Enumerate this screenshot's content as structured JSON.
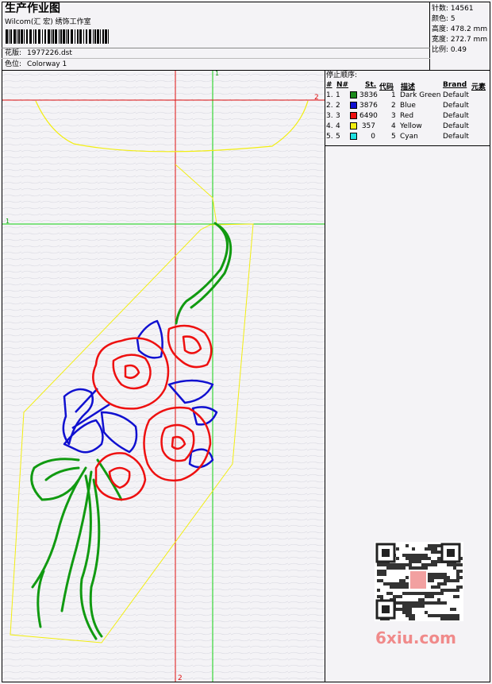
{
  "header": {
    "title": "生产作业图",
    "company": "Wilcom(汇 宏) 绣饰工作室",
    "design_label": "花版:",
    "design_value": "1977226.dst",
    "colorway_label": "色位:",
    "colorway_value": "Colorway 1"
  },
  "info": [
    {
      "label": "针数:",
      "value": "14561"
    },
    {
      "label": "颜色:",
      "value": "5"
    },
    {
      "label": "高度:",
      "value": "478.2 mm"
    },
    {
      "label": "宽度:",
      "value": "272.7 mm"
    },
    {
      "label": "比例:",
      "value": "0.49"
    }
  ],
  "stop_sequence": {
    "title": "停止顺序:",
    "columns": [
      "#",
      "N#",
      "St.",
      "代码",
      "描述",
      "Brand",
      "元素"
    ],
    "rows": [
      {
        "idx": "1.",
        "n": "1",
        "st": "3836",
        "code": "1",
        "desc": "Dark Green",
        "brand": "Default",
        "color": "#1a8a1a"
      },
      {
        "idx": "2.",
        "n": "2",
        "st": "3876",
        "code": "2",
        "desc": "Blue",
        "brand": "Default",
        "color": "#1010d0"
      },
      {
        "idx": "3.",
        "n": "3",
        "st": "6490",
        "code": "3",
        "desc": "Red",
        "brand": "Default",
        "color": "#ee1010"
      },
      {
        "idx": "4.",
        "n": "4",
        "st": "357",
        "code": "4",
        "desc": "Yellow",
        "brand": "Default",
        "color": "#f2ee10"
      },
      {
        "idx": "5.",
        "n": "5",
        "st": "0",
        "code": "5",
        "desc": "Cyan",
        "brand": "Default",
        "color": "#20e0e0"
      }
    ]
  },
  "guides": {
    "label_v1": "1",
    "label_v2": "2",
    "label_h1": "1",
    "label_h2": "2",
    "label_v2_bottom": "2"
  },
  "watermark": "6xiu.com"
}
